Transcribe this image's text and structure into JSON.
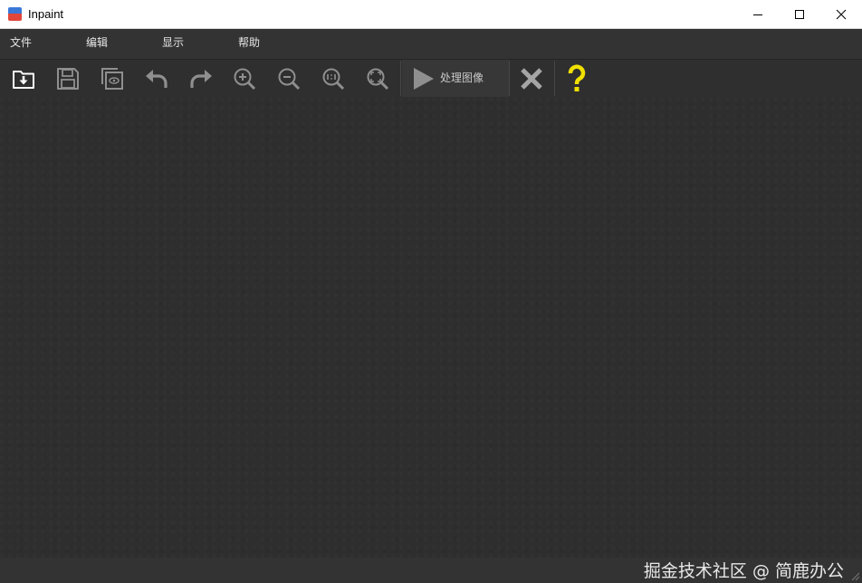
{
  "window": {
    "title": "Inpaint"
  },
  "menu": {
    "items": [
      {
        "label": "文件"
      },
      {
        "label": "编辑"
      },
      {
        "label": "显示"
      },
      {
        "label": "帮助"
      }
    ]
  },
  "toolbar": {
    "process_label": "处理图像",
    "icons": {
      "open": "open-folder-icon",
      "save": "save-disk-icon",
      "preview": "layers-preview-icon",
      "undo": "undo-arrow-icon",
      "redo": "redo-arrow-icon",
      "zoom_in": "zoom-in-icon",
      "zoom_out": "zoom-out-icon",
      "actual_size": "zoom-actual-size-icon",
      "fit": "zoom-fit-icon",
      "process": "play-icon",
      "cancel": "x-icon",
      "help": "question-mark-icon"
    },
    "colors": {
      "help_accent": "#f0e000",
      "icon_gray": "#a8a8a8",
      "open_icon": "#ffffff"
    }
  },
  "status": {
    "watermark": "掘金技术社区 @ 简鹿办公"
  }
}
